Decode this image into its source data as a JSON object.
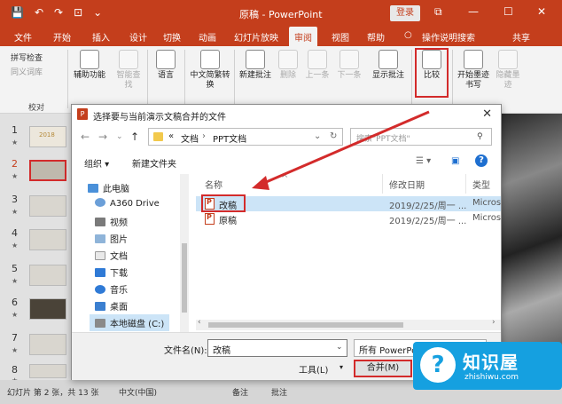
{
  "app": {
    "title": "原稿 - PowerPoint",
    "login": "登录",
    "qat_save": "💾",
    "qat_undo": "↶",
    "qat_redo": "↷",
    "qat_present": "⊡",
    "qat_more": "⌄",
    "restore": "⧉",
    "minimize": "—",
    "maximize": "☐",
    "close": "✕"
  },
  "tabs": [
    "文件",
    "开始",
    "插入",
    "设计",
    "切换",
    "动画",
    "幻灯片放映",
    "审阅",
    "视图",
    "帮助",
    "操作说明搜索"
  ],
  "share": "共享",
  "ribbon": {
    "proof_spell": "拼写检查",
    "proof_thesaurus": "同义词库",
    "group_proof": "校对",
    "accessibility": "辅助功能",
    "smart_lookup": "智能查找",
    "language": "语言",
    "chinese_convert": "中文简繁转换",
    "new_comment": "新建批注",
    "delete": "删除",
    "prev": "上一条",
    "next": "下一条",
    "show_comments": "显示批注",
    "compare": "比较",
    "ink_start": "开始墨迹书写",
    "ink_hide": "隐藏墨迹"
  },
  "slides": [
    {
      "num": "1"
    },
    {
      "num": "2"
    },
    {
      "num": "3"
    },
    {
      "num": "4"
    },
    {
      "num": "5"
    },
    {
      "num": "6"
    },
    {
      "num": "7"
    },
    {
      "num": "8"
    }
  ],
  "slide1_text": "2018",
  "status": {
    "slide_info": "幻灯片 第 2 张，共 13 张",
    "lang": "中文(中国)",
    "notes": "备注",
    "comments": "批注"
  },
  "dialog": {
    "title": "选择要与当前演示文稿合并的文件",
    "breadcrumb_sep": "«",
    "path_1": "文档",
    "path_2": "PPT文档",
    "search_placeholder": "搜索\"PPT文档\"",
    "organize": "组织 ▾",
    "new_folder": "新建文件夹",
    "nav": [
      "此电脑",
      "A360 Drive",
      "视频",
      "图片",
      "文档",
      "下载",
      "音乐",
      "桌面",
      "本地磁盘 (C:)"
    ],
    "col_name": "名称",
    "col_date": "修改日期",
    "col_type": "类型",
    "files": [
      {
        "name": "改稿",
        "date": "2019/2/25/周一 ...",
        "type": "Micros"
      },
      {
        "name": "原稿",
        "date": "2019/2/25/周一 ...",
        "type": "Micros"
      }
    ],
    "filename_label": "文件名(N):",
    "filename_value": "改稿",
    "filetype_value": "所有 PowerPoint",
    "tools": "工具(L)",
    "merge": "合并(M)"
  },
  "watermark": {
    "name": "知识屋",
    "url": "zhishiwu.com",
    "logo": "?"
  },
  "colors": {
    "accent": "#c43e1c",
    "highlight_red": "#d32b2b",
    "selection": "#cce4f7",
    "watermark_blue": "#15a0e0"
  }
}
